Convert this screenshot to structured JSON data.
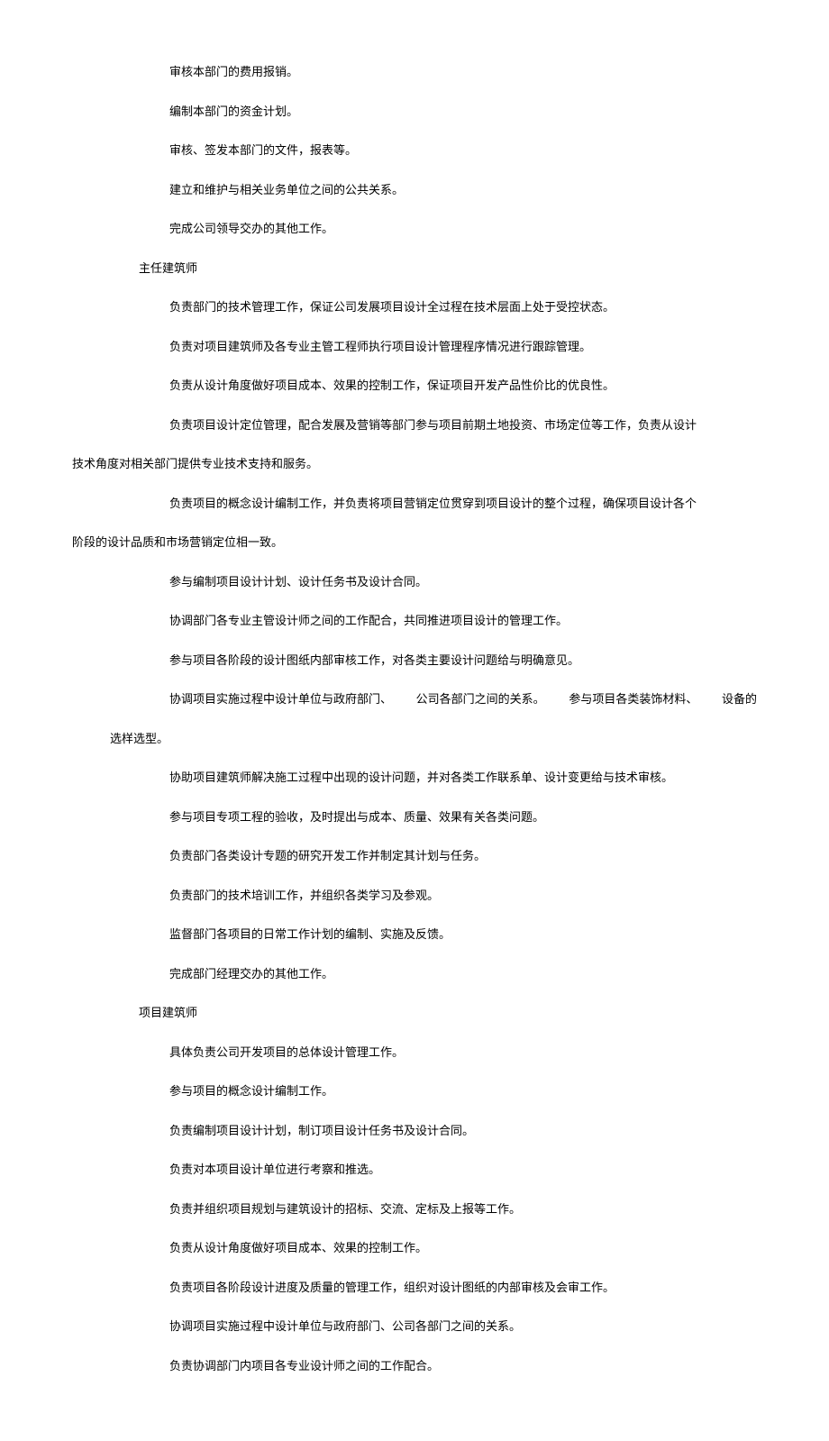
{
  "section1": {
    "items": [
      "审核本部门的费用报销。",
      "编制本部门的资金计划。",
      "审核、签发本部门的文件，报表等。",
      "建立和维护与相关业务单位之间的公共关系。",
      "完成公司领导交办的其他工作。"
    ]
  },
  "section2": {
    "heading": "主任建筑师",
    "items": {
      "l1": "负责部门的技术管理工作，保证公司发展项目设计全过程在技术层面上处于受控状态。",
      "l2": "负责对项目建筑师及各专业主管工程师执行项目设计管理程序情况进行跟踪管理。",
      "l3": "负责从设计角度做好项目成本、效果的控制工作，保证项目开发产品性价比的优良性。",
      "l4a": "负责项目设计定位管理，配合发展及营销等部门参与项目前期土地投资、市场定位等工作，负责从设计",
      "l4b": "技术角度对相关部门提供专业技术支持和服务。",
      "l5a": "负责项目的概念设计编制工作，并负责将项目营销定位贯穿到项目设计的整个过程，确保项目设计各个",
      "l5b": "阶段的设计品质和市场营销定位相一致。",
      "l6": "参与编制项目设计计划、设计任务书及设计合同。",
      "l7": "协调部门各专业主管设计师之间的工作配合，共同推进项目设计的管理工作。",
      "l8": "参与项目各阶段的设计图纸内部审核工作，对各类主要设计问题给与明确意见。",
      "l9_pieces": {
        "a": "协调项目实施过程中设计单位与政府部门、",
        "b": "公司各部门之间的关系。",
        "c": "参与项目各类装饰材料、",
        "d": "设备的"
      },
      "l9b": "选样选型。",
      "l10": "协助项目建筑师解决施工过程中出现的设计问题，并对各类工作联系单、设计变更给与技术审核。",
      "l11": "参与项目专项工程的验收，及时提出与成本、质量、效果有关各类问题。",
      "l12": "负责部门各类设计专题的研究开发工作并制定其计划与任务。",
      "l13": "负责部门的技术培训工作，并组织各类学习及参观。",
      "l14": "监督部门各项目的日常工作计划的编制、实施及反馈。",
      "l15": "完成部门经理交办的其他工作。"
    }
  },
  "section3": {
    "heading": "项目建筑师",
    "items": [
      "具体负责公司开发项目的总体设计管理工作。",
      "参与项目的概念设计编制工作。",
      "负责编制项目设计计划，制订项目设计任务书及设计合同。",
      "负责对本项目设计单位进行考察和推选。",
      "负责并组织项目规划与建筑设计的招标、交流、定标及上报等工作。",
      "负责从设计角度做好项目成本、效果的控制工作。",
      "负责项目各阶段设计进度及质量的管理工作，组织对设计图纸的内部审核及会审工作。",
      "协调项目实施过程中设计单位与政府部门、公司各部门之间的关系。",
      "负责协调部门内项目各专业设计师之间的工作配合。"
    ]
  }
}
